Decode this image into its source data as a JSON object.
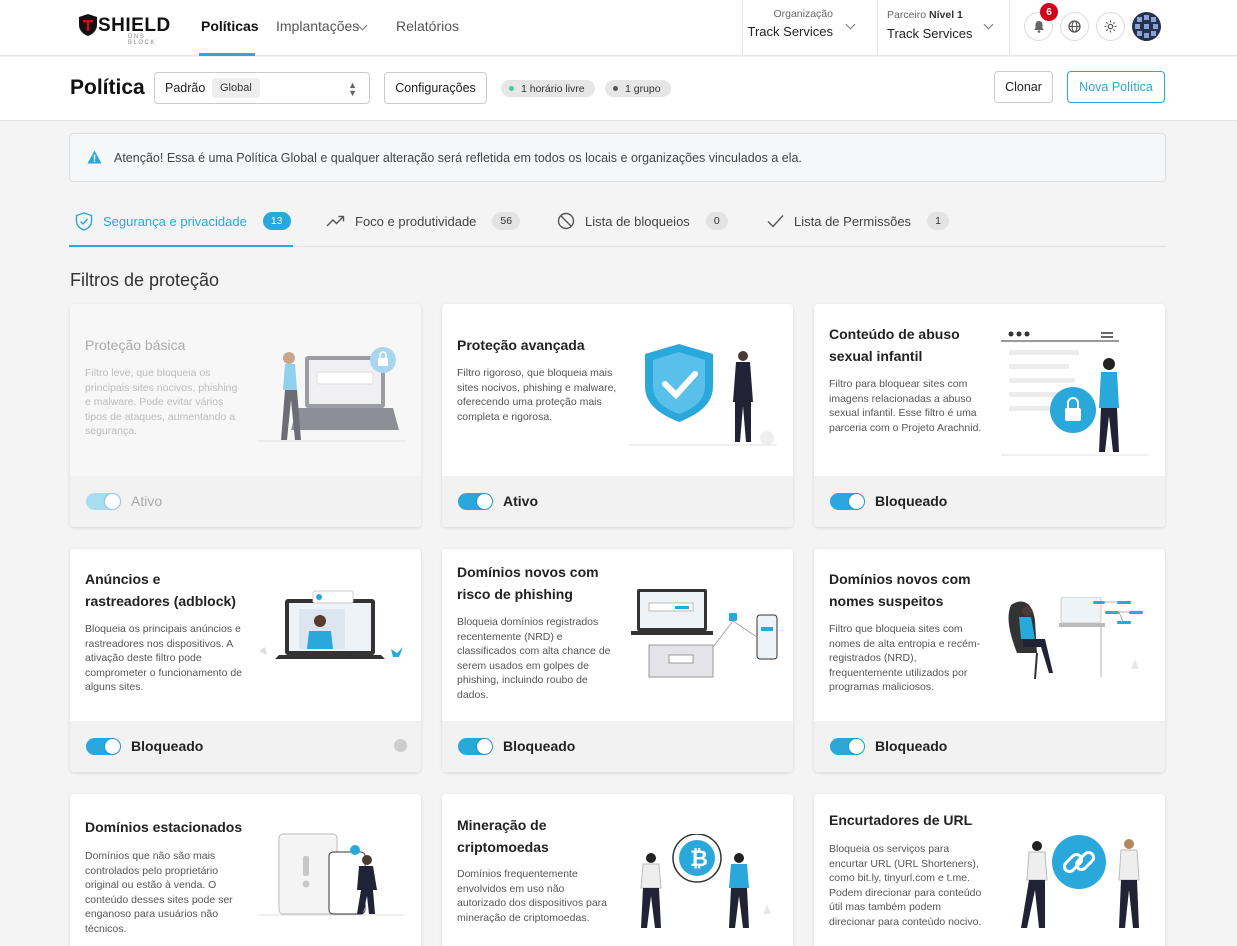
{
  "header": {
    "logo_text": "SHIELD",
    "logo_tagline": "DNS BLOCK",
    "nav": [
      {
        "label": "Políticas"
      },
      {
        "label": "Implantações"
      },
      {
        "label": "Relatórios"
      }
    ],
    "organization": {
      "caption": "Organização",
      "value": "Track Services"
    },
    "partner": {
      "caption": "Parceiro",
      "caption_bold": "Nível 1",
      "value": "Track Services"
    },
    "notifications_count": "6"
  },
  "policy": {
    "title": "Política",
    "select_value": "Padrão",
    "select_tag": "Global",
    "config_button": "Configurações",
    "chips": [
      {
        "label": "1 horário livre",
        "dot_color": "#3ecf8e"
      },
      {
        "label": "1 grupo",
        "dot_color": "#555555"
      }
    ],
    "clone_button": "Clonar",
    "new_button": "Nova Política"
  },
  "alert": {
    "text": "Atenção! Essa é uma Política Global e qualquer alteração será refletida em todos os locais e organizações vinculados a ela."
  },
  "tabs": [
    {
      "label": "Segurança e privacidade",
      "count": "13"
    },
    {
      "label": "Foco e produtividade",
      "count": "56"
    },
    {
      "label": "Lista de bloqueios",
      "count": "0"
    },
    {
      "label": "Lista de Permissões",
      "count": "1"
    }
  ],
  "section_title": "Filtros de proteção",
  "cards": [
    {
      "title": "Proteção básica",
      "description": "Filtro leve, que bloqueia os principais sites nocivos, phishing e malware. Pode evitar vários tipos de ataques, aumentando a segurança.",
      "status": "Ativo"
    },
    {
      "title": "Proteção avançada",
      "description": "Filtro rigoroso, que bloqueia mais sites nocivos, phishing e malware, oferecendo uma proteção mais completa e rigorosa.",
      "status": "Ativo"
    },
    {
      "title": "Conteúdo de abuso sexual infantil",
      "description": "Filtro para bloquear sites com imagens relacionadas a abuso sexual infantil. Esse filtro é uma parceria com o Projeto Arachnid.",
      "status": "Bloqueado"
    },
    {
      "title": "Anúncios e rastreadores (adblock)",
      "description": "Bloqueia os principais anúncios e rastreadores nos dispositivos. A ativação deste filtro pode comprometer o funcionamento de alguns sites.",
      "status": "Bloqueado"
    },
    {
      "title": "Domínios novos com risco de phishing",
      "description": "Bloqueia domínios registrados recentemente (NRD) e classificados com alta chance de serem usados em golpes de phishing, incluindo roubo de dados.",
      "status": "Bloqueado"
    },
    {
      "title": "Domínios novos com nomes suspeitos",
      "description": "Filtro que bloqueia sites com nomes de alta entropia e recém-registrados (NRD), frequentemente utilizados por programas maliciosos.",
      "status": "Bloqueado"
    },
    {
      "title": "Domínios estacionados",
      "description": "Domínios que não são mais controlados pelo proprietário original ou estão à venda. O conteúdo desses sites pode ser enganoso para usuários não técnicos."
    },
    {
      "title": "Mineração de criptomoedas",
      "description": "Domínios frequentemente envolvidos em uso não autorizado dos dispositivos para mineração de criptomoedas."
    },
    {
      "title": "Encurtadores de URL",
      "description": "Bloqueia os serviços para encurtar URL (URL Shorteners), como bit.ly, tinyurl.com e t.me. Podem direcionar para conteúdo útil mas também podem direcionar para conteúdo nocivo."
    }
  ],
  "colors": {
    "accent": "#2aa8dc",
    "danger": "#d0021b"
  },
  "icons": [
    "shield-icon",
    "chevron-down-icon",
    "bell-icon",
    "globe-icon",
    "sun-icon",
    "warning-icon",
    "shield-check-icon",
    "trend-up-icon",
    "block-icon",
    "check-icon",
    "clock-icon"
  ]
}
